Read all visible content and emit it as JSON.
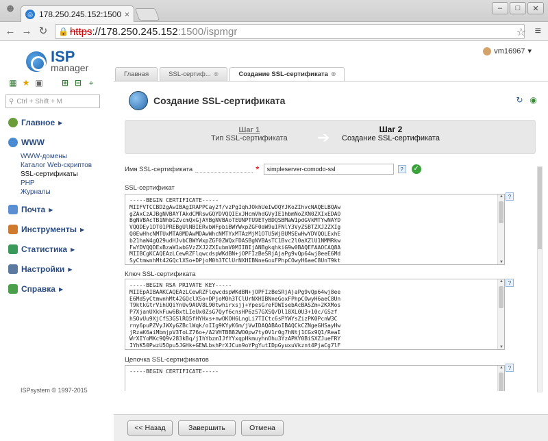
{
  "browser": {
    "tab_title": "178.250.245.152:1500",
    "tab_close": "×",
    "url_https": "https",
    "url_host": "://178.250.245.152",
    "url_path": ":1500/ispmgr"
  },
  "app": {
    "logo_top": "ISP",
    "logo_bottom": "manager",
    "user": "vm16967",
    "search_placeholder": "Ctrl + Shift + M",
    "copyright": "ISPsystem © 1997-2015"
  },
  "sidebar": {
    "items": [
      {
        "label": "Главное"
      },
      {
        "label": "WWW"
      },
      {
        "label": "Почта"
      },
      {
        "label": "Инструменты"
      },
      {
        "label": "Статистика"
      },
      {
        "label": "Настройки"
      },
      {
        "label": "Справка"
      }
    ],
    "www_sub": [
      "WWW-домены",
      "Каталог Web-скриптов",
      "SSL-сертификаты",
      "PHP",
      "Журналы"
    ]
  },
  "content_tabs": [
    {
      "label": "Главная"
    },
    {
      "label": "SSL-сертиф..."
    },
    {
      "label": "Создание SSL-сертификата"
    }
  ],
  "panel": {
    "title": "Создание SSL-сертификата",
    "step1_num": "Шаг 1",
    "step1_name": "Тип SSL-сертификата",
    "step2_num": "Шаг 2",
    "step2_name": "Создание SSL-сертификата"
  },
  "form": {
    "name_label": "Имя SSL-сертификата",
    "name_value": "simpleserver-comodo-ssl",
    "cert_label": "SSL-сертификат",
    "cert_value": "-----BEGIN CERTIFICATE-----\nMIIFVTCCBD2gAwIBAgIRAPPCay2f/vzPgIqhJOkhUeIwDQYJKoZIhvcNAQELBQAw\ngZAxCzAJBgNVBAYTAkdCMRswGQYDVQQIExJHcmVhdGVyIE1hbmNoZXN0ZXIxEDAO\nBgNVBAcTB1NhbGZvcmQxGjAYBgNVBAoTEUNPTU9ETyBDQSBMaW1pdGVkMTYwNAYD\nVQQDEy1DT01PREBgUlNBIERvbWFpbiBWYWxpZGF0aW9uIFNlY3VyZSBTZXJ2ZXIg\nQ0EwHhcNMTUxMTA0MDAwMDAwWhcNMTYxMTAzMjM1OTU5WjBUMSEwHwYDVQQLExhE\nb21haW4gQ29udHJvbCBWYWxpZGF0ZWQxFDASBgNVBAsTC1Bvc2l0aXZlU1NMMRkw\nFwYDVQQDExBzaW1wbGVzZXJ2ZXIubmV0MIIBIjANBgkqhkiG9w0BAQEFAAOCAQ8A\nMIIBCgKCAQEAzLCewRZFlqwcdspWKdBN+jOPFIzBeSRjAjaPg9vQp64wj8eeE6Md\nSyCtmwnhMt42GQclXSo+DPjoM0h3TClUrNXHIBNneGoxFPhpCOwyH6aeC8UnT9kt",
    "key_label": "Ключ SSL-сертификата",
    "key_value": "-----BEGIN RSA PRIVATE KEY-----\nMIIEpAIBAAKCAQEAzLCewRZFlqwcdspWKdBN+jOPFIzBeSRjAjaPg9vQp64wj8ee\nE6MdSyCtmwnhMt42GQclXSo+DPjoM0h3TClUrNXHIBNneGoxFPhpCOwyH6aeC8Un\nT9ktkGtrVihUQiYnUv9AUV8L90twhirxsjj+YpesGreFDWIsebAcBASZm+2KXMos\nP7XjanUXkkFuw6BxtLIeUx0ZsG7Qyf6cnsHP6zS7GXSQ/Dl18XL0U3+10c/GSzf\nhSOvUu9XjCfS3GSlRQ5fHYHxs+nwOKOH6LngLi7TICtc6sPYWYsZizPK0PcnW3C\nrny6puPZVyJWXyGZBclWqk/oIIg9KYyK6m/jVwIDAQABAoIBAQCkCZNgeGHSayHw\njRzaK6aiMbmjpV3ToLZ76o+/A2VHTBB82WO0pw7ty0V1r0g7hNtj1CGx9Q1/ReaI\nWrXIYoMKc9Q9v283kBq/jIhYbzmIJfYYxqpHkmuyhnOhu3YzAPKY0BiSXZJueFRY\nIYhK50PwzU5Opu5JGHk+GEWLbshPrXJCun9oYPgYutIDpGyuxuVkznt4PjaCg7lF",
    "chain_label": "Цепочка SSL-сертификатов",
    "chain_value": "-----BEGIN CERTIFICATE-----"
  },
  "buttons": {
    "back": "<< Назад",
    "finish": "Завершить",
    "cancel": "Отмена"
  },
  "colors": {
    "accent": "#1a5fa8",
    "nav_text": "#2a4b80",
    "ok": "#3aa23a",
    "required": "#dd0000"
  }
}
